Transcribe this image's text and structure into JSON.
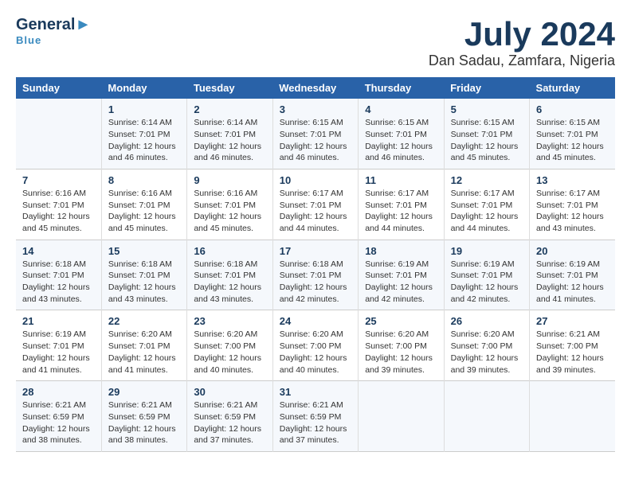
{
  "header": {
    "logo_line1": "General",
    "logo_line2": "Blue",
    "month": "July 2024",
    "location": "Dan Sadau, Zamfara, Nigeria"
  },
  "weekdays": [
    "Sunday",
    "Monday",
    "Tuesday",
    "Wednesday",
    "Thursday",
    "Friday",
    "Saturday"
  ],
  "weeks": [
    [
      {
        "day": "",
        "info": ""
      },
      {
        "day": "1",
        "info": "Sunrise: 6:14 AM\nSunset: 7:01 PM\nDaylight: 12 hours\nand 46 minutes."
      },
      {
        "day": "2",
        "info": "Sunrise: 6:14 AM\nSunset: 7:01 PM\nDaylight: 12 hours\nand 46 minutes."
      },
      {
        "day": "3",
        "info": "Sunrise: 6:15 AM\nSunset: 7:01 PM\nDaylight: 12 hours\nand 46 minutes."
      },
      {
        "day": "4",
        "info": "Sunrise: 6:15 AM\nSunset: 7:01 PM\nDaylight: 12 hours\nand 46 minutes."
      },
      {
        "day": "5",
        "info": "Sunrise: 6:15 AM\nSunset: 7:01 PM\nDaylight: 12 hours\nand 45 minutes."
      },
      {
        "day": "6",
        "info": "Sunrise: 6:15 AM\nSunset: 7:01 PM\nDaylight: 12 hours\nand 45 minutes."
      }
    ],
    [
      {
        "day": "7",
        "info": "Sunrise: 6:16 AM\nSunset: 7:01 PM\nDaylight: 12 hours\nand 45 minutes."
      },
      {
        "day": "8",
        "info": "Sunrise: 6:16 AM\nSunset: 7:01 PM\nDaylight: 12 hours\nand 45 minutes."
      },
      {
        "day": "9",
        "info": "Sunrise: 6:16 AM\nSunset: 7:01 PM\nDaylight: 12 hours\nand 45 minutes."
      },
      {
        "day": "10",
        "info": "Sunrise: 6:17 AM\nSunset: 7:01 PM\nDaylight: 12 hours\nand 44 minutes."
      },
      {
        "day": "11",
        "info": "Sunrise: 6:17 AM\nSunset: 7:01 PM\nDaylight: 12 hours\nand 44 minutes."
      },
      {
        "day": "12",
        "info": "Sunrise: 6:17 AM\nSunset: 7:01 PM\nDaylight: 12 hours\nand 44 minutes."
      },
      {
        "day": "13",
        "info": "Sunrise: 6:17 AM\nSunset: 7:01 PM\nDaylight: 12 hours\nand 43 minutes."
      }
    ],
    [
      {
        "day": "14",
        "info": "Sunrise: 6:18 AM\nSunset: 7:01 PM\nDaylight: 12 hours\nand 43 minutes."
      },
      {
        "day": "15",
        "info": "Sunrise: 6:18 AM\nSunset: 7:01 PM\nDaylight: 12 hours\nand 43 minutes."
      },
      {
        "day": "16",
        "info": "Sunrise: 6:18 AM\nSunset: 7:01 PM\nDaylight: 12 hours\nand 43 minutes."
      },
      {
        "day": "17",
        "info": "Sunrise: 6:18 AM\nSunset: 7:01 PM\nDaylight: 12 hours\nand 42 minutes."
      },
      {
        "day": "18",
        "info": "Sunrise: 6:19 AM\nSunset: 7:01 PM\nDaylight: 12 hours\nand 42 minutes."
      },
      {
        "day": "19",
        "info": "Sunrise: 6:19 AM\nSunset: 7:01 PM\nDaylight: 12 hours\nand 42 minutes."
      },
      {
        "day": "20",
        "info": "Sunrise: 6:19 AM\nSunset: 7:01 PM\nDaylight: 12 hours\nand 41 minutes."
      }
    ],
    [
      {
        "day": "21",
        "info": "Sunrise: 6:19 AM\nSunset: 7:01 PM\nDaylight: 12 hours\nand 41 minutes."
      },
      {
        "day": "22",
        "info": "Sunrise: 6:20 AM\nSunset: 7:01 PM\nDaylight: 12 hours\nand 41 minutes."
      },
      {
        "day": "23",
        "info": "Sunrise: 6:20 AM\nSunset: 7:00 PM\nDaylight: 12 hours\nand 40 minutes."
      },
      {
        "day": "24",
        "info": "Sunrise: 6:20 AM\nSunset: 7:00 PM\nDaylight: 12 hours\nand 40 minutes."
      },
      {
        "day": "25",
        "info": "Sunrise: 6:20 AM\nSunset: 7:00 PM\nDaylight: 12 hours\nand 39 minutes."
      },
      {
        "day": "26",
        "info": "Sunrise: 6:20 AM\nSunset: 7:00 PM\nDaylight: 12 hours\nand 39 minutes."
      },
      {
        "day": "27",
        "info": "Sunrise: 6:21 AM\nSunset: 7:00 PM\nDaylight: 12 hours\nand 39 minutes."
      }
    ],
    [
      {
        "day": "28",
        "info": "Sunrise: 6:21 AM\nSunset: 6:59 PM\nDaylight: 12 hours\nand 38 minutes."
      },
      {
        "day": "29",
        "info": "Sunrise: 6:21 AM\nSunset: 6:59 PM\nDaylight: 12 hours\nand 38 minutes."
      },
      {
        "day": "30",
        "info": "Sunrise: 6:21 AM\nSunset: 6:59 PM\nDaylight: 12 hours\nand 37 minutes."
      },
      {
        "day": "31",
        "info": "Sunrise: 6:21 AM\nSunset: 6:59 PM\nDaylight: 12 hours\nand 37 minutes."
      },
      {
        "day": "",
        "info": ""
      },
      {
        "day": "",
        "info": ""
      },
      {
        "day": "",
        "info": ""
      }
    ]
  ]
}
